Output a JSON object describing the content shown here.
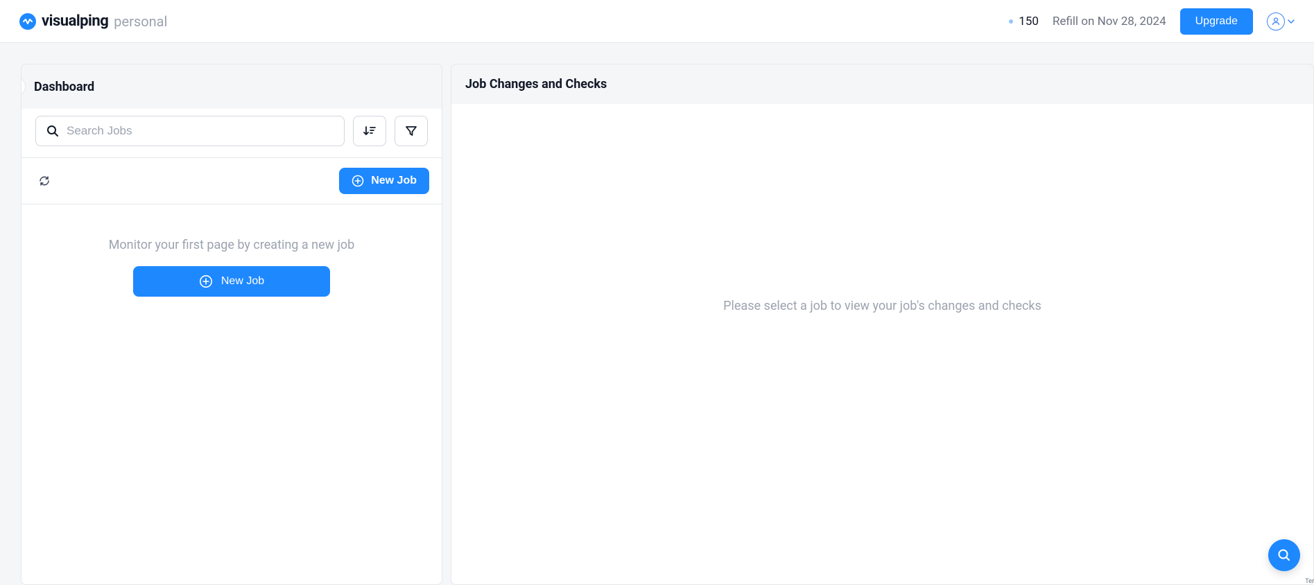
{
  "header": {
    "logo_text": "visualping",
    "logo_suffix": "personal",
    "credits": "150",
    "refill": "Refill on Nov 28, 2024",
    "upgrade_label": "Upgrade"
  },
  "left_panel": {
    "title": "Dashboard",
    "search_placeholder": "Search Jobs",
    "new_job_label": "New Job",
    "empty_message": "Monitor your first page by creating a new job",
    "empty_cta_label": "New Job"
  },
  "right_panel": {
    "title": "Job Changes and Checks",
    "placeholder": "Please select a job to view your job's changes and checks"
  },
  "footer": {
    "ter": "Ter"
  },
  "colors": {
    "primary": "#1e88ff",
    "text_muted": "#9ca3af",
    "text_dark": "#111827"
  }
}
